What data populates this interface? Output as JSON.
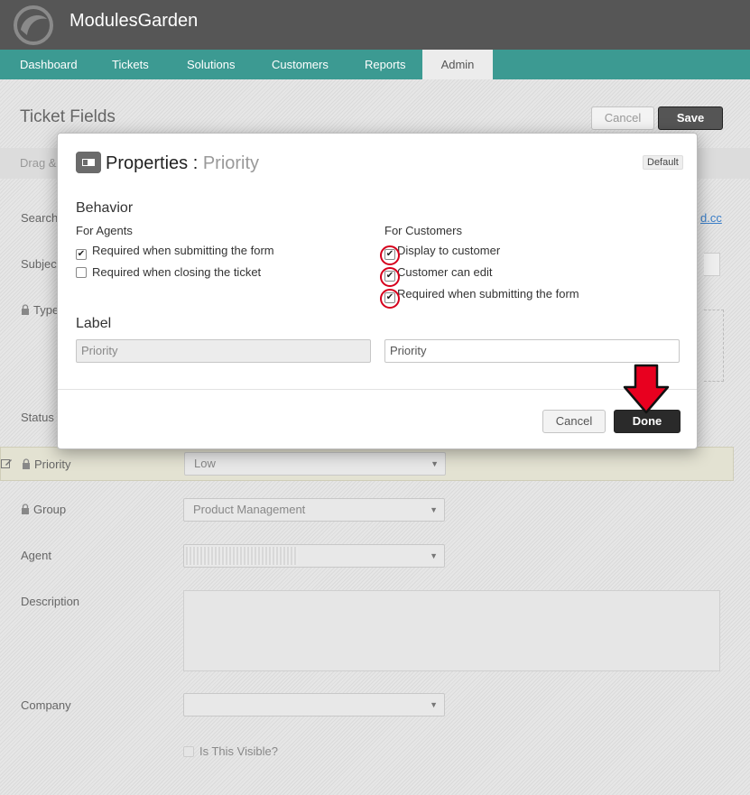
{
  "app": {
    "brand": "ModulesGarden"
  },
  "nav": {
    "items": [
      {
        "label": "Dashboard"
      },
      {
        "label": "Tickets"
      },
      {
        "label": "Solutions"
      },
      {
        "label": "Customers"
      },
      {
        "label": "Reports"
      },
      {
        "label": "Admin"
      }
    ],
    "active": "Admin"
  },
  "page": {
    "title": "Ticket Fields",
    "cancel_label": "Cancel",
    "save_label": "Save",
    "drag_hint": "Drag &",
    "link_text": "d.cc",
    "fields": {
      "search": "Search",
      "subject": "Subjec",
      "type": "Type",
      "status": "Status",
      "priority": "Priority",
      "priority_value": "Low",
      "group": "Group",
      "group_value": "Product Management",
      "agent": "Agent",
      "description": "Description",
      "company": "Company",
      "visible_label": "Is This Visible?"
    }
  },
  "modal": {
    "title": "Properties : ",
    "title_field": "Priority",
    "badge": "Default",
    "behavior_title": "Behavior",
    "agents_title": "For Agents",
    "customers_title": "For Customers",
    "agents": [
      {
        "label": "Required when submitting the form",
        "checked": true
      },
      {
        "label": "Required when closing the ticket",
        "checked": false
      }
    ],
    "customers": [
      {
        "label": "Display to customer",
        "checked": true
      },
      {
        "label": "Customer can edit",
        "checked": true
      },
      {
        "label": "Required when submitting the form",
        "checked": true
      }
    ],
    "label_title": "Label",
    "label_agent_value": "Priority",
    "label_customer_value": "Priority",
    "cancel_label": "Cancel",
    "done_label": "Done"
  },
  "colors": {
    "topbar": "#565656",
    "navbar": "#3c9a92",
    "highlight_ring": "#d6001c",
    "arrow": "#e8001f"
  }
}
